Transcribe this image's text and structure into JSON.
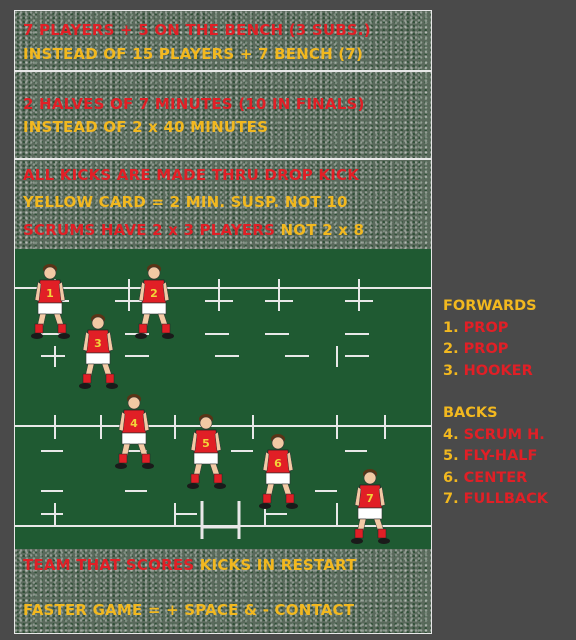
{
  "rules": {
    "line1_red": "7 PLAYERS + 5 ON THE BENCH (3 SUBS.)",
    "line1_yellow": "INSTEAD OF 15 PLAYERS + 7 BENCH (7)",
    "line2_red": "2 HALVES OF 7 MINUTES (10 IN FINALS)",
    "line2_yellow": "INSTEAD OF 2 x 40 MINUTES",
    "line3_red": "ALL KICKS ARE MADE THRU DROP KICK",
    "line4_yellow": "YELLOW CARD = 2 MIN. SUSP. NOT 10",
    "line5_red": "SCRUMS HAVE 2 x 3 PLAYERS",
    "line5_yellow": " NOT 2 x 8",
    "footer1_red": "TEAM THAT SCORES",
    "footer1_yellow": " KICKS IN RESTART",
    "footer2_yellow": "FASTER GAME = + SPACE & - CONTACT"
  },
  "legend": {
    "forwards_title": "FORWARDS",
    "forwards": [
      {
        "num": "1.",
        "label": "PROP"
      },
      {
        "num": "2.",
        "label": "PROP"
      },
      {
        "num": "3.",
        "label": "HOOKER"
      }
    ],
    "backs_title": "BACKS",
    "backs": [
      {
        "num": "4.",
        "label": "SCRUM H."
      },
      {
        "num": "5.",
        "label": "FLY-HALF"
      },
      {
        "num": "6.",
        "label": "CENTER"
      },
      {
        "num": "7.",
        "label": "FULLBACK"
      }
    ]
  },
  "players": [
    {
      "number": "1"
    },
    {
      "number": "2"
    },
    {
      "number": "3"
    },
    {
      "number": "4"
    },
    {
      "number": "5"
    },
    {
      "number": "6"
    },
    {
      "number": "7"
    }
  ],
  "colors": {
    "jersey": "#e11f26",
    "shorts": "#ffffff",
    "text_red": "#e11f26",
    "text_yellow": "#f2b81f",
    "field": "#1f5a32"
  }
}
